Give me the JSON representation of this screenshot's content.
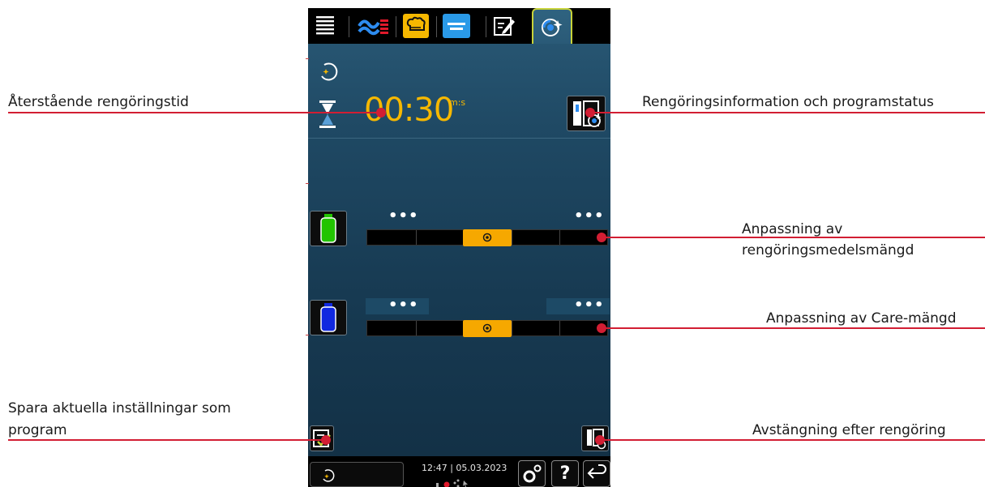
{
  "callouts": {
    "remaining_time": "Återstående rengöringstid",
    "cleaning_info": "Rengöringsinformation och programstatus",
    "detergent_line1": "Anpassning av",
    "detergent_line2": "rengöringsmedelsmängd",
    "care_amount": "Anpassning av Care-mängd",
    "save_line1": "Spara aktuella inställningar som",
    "save_line2": "program",
    "shutdown": "Avstängning efter rengöring"
  },
  "screen": {
    "timer_value": "00:30",
    "timer_unit": "m:s",
    "slider_dots_left": "•••",
    "slider_dots_right": "•••",
    "detergent_level": 0.5,
    "care_level": 0.5,
    "time": "12:47",
    "date": "05.03.2023",
    "help_label": "?"
  },
  "colors": {
    "accent": "#f6b800",
    "callout_line": "#d21e33",
    "tab_active_border": "#c8d33a",
    "detergent_bottle": "#22c400",
    "care_bottle": "#1028e0"
  },
  "icons": {
    "tabs": [
      "menu-icon",
      "cooking-paths-icon",
      "chef-hat-icon",
      "programs-icon",
      "edit-program-icon",
      "cleaning-icon"
    ],
    "status": [
      "cleaning-status-icon",
      "hourglass-icon",
      "cleaning-info-icon",
      "save-program-icon",
      "shutdown-icon",
      "settings-icon",
      "help-icon",
      "back-icon"
    ]
  }
}
